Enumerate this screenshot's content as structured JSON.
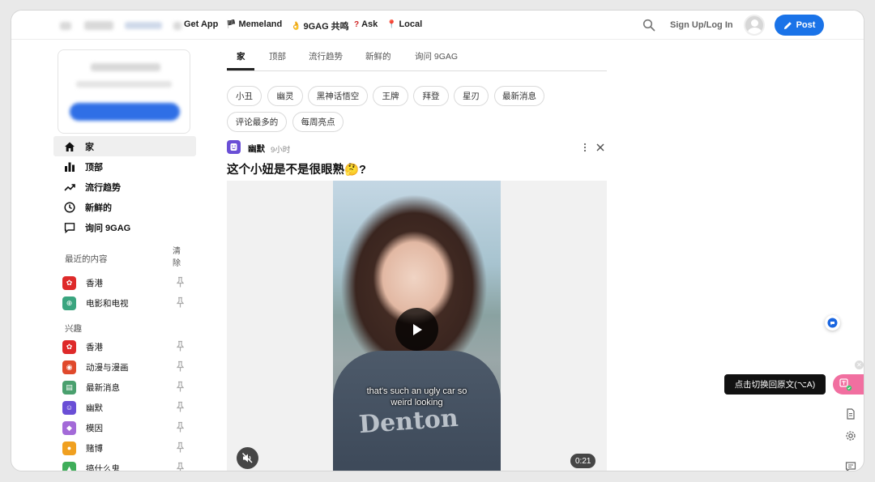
{
  "header": {
    "links": [
      {
        "icon": "phone-icon",
        "label": "Get App"
      },
      {
        "icon": "flag-icon",
        "label": "Memeland"
      },
      {
        "icon": "emoji-icon",
        "label": "9GAG 共鸣"
      },
      {
        "icon": "question-icon",
        "label": "Ask"
      },
      {
        "icon": "pin-location-icon",
        "label": "Local"
      }
    ],
    "signup_label": "Sign Up/Log In",
    "post_label": "Post"
  },
  "sidebar": {
    "nav": [
      {
        "icon": "home-icon",
        "label": "家"
      },
      {
        "icon": "bar-chart-icon",
        "label": "顶部"
      },
      {
        "icon": "trending-icon",
        "label": "流行趋势"
      },
      {
        "icon": "clock-icon",
        "label": "新鲜的"
      },
      {
        "icon": "chat-icon",
        "label": "询问 9GAG"
      }
    ],
    "recent_title": "最近的内容",
    "clear_label": "清除",
    "recent": [
      {
        "label": "香港",
        "color": "#de2a2a"
      },
      {
        "label": "电影和电视",
        "color": "#3aa57f"
      }
    ],
    "interests_title": "兴趣",
    "interests": [
      {
        "label": "香港",
        "color": "#de2a2a"
      },
      {
        "label": "动漫与漫画",
        "color": "#e0492c"
      },
      {
        "label": "最新消息",
        "color": "#4aa06e"
      },
      {
        "label": "幽默",
        "color": "#6a4fd6"
      },
      {
        "label": "模因",
        "color": "#a36ad8"
      },
      {
        "label": "赌博",
        "color": "#f0a020"
      },
      {
        "label": "搞什么鬼",
        "color": "#3fae5a"
      }
    ]
  },
  "main": {
    "tabs": [
      "家",
      "顶部",
      "流行趋势",
      "新鲜的",
      "询问 9GAG"
    ],
    "chips": [
      "小丑",
      "幽灵",
      "黑神话悟空",
      "王牌",
      "拜登",
      "星刃",
      "最新消息",
      "评论最多的",
      "每周亮点"
    ]
  },
  "post": {
    "section": "幽默",
    "time": "9小时",
    "title": "这个小妞是不是很眼熟🤔?",
    "caption_line1": "that's such an ugly car so",
    "caption_line2": "weird looking",
    "duration": "0:21",
    "shirt_text": "Denton"
  },
  "tools": {
    "tooltip": "点击切换回原文(⌥A)"
  },
  "colors": {
    "accent": "#1a73e8",
    "translate_pill": "#f16fa0"
  }
}
